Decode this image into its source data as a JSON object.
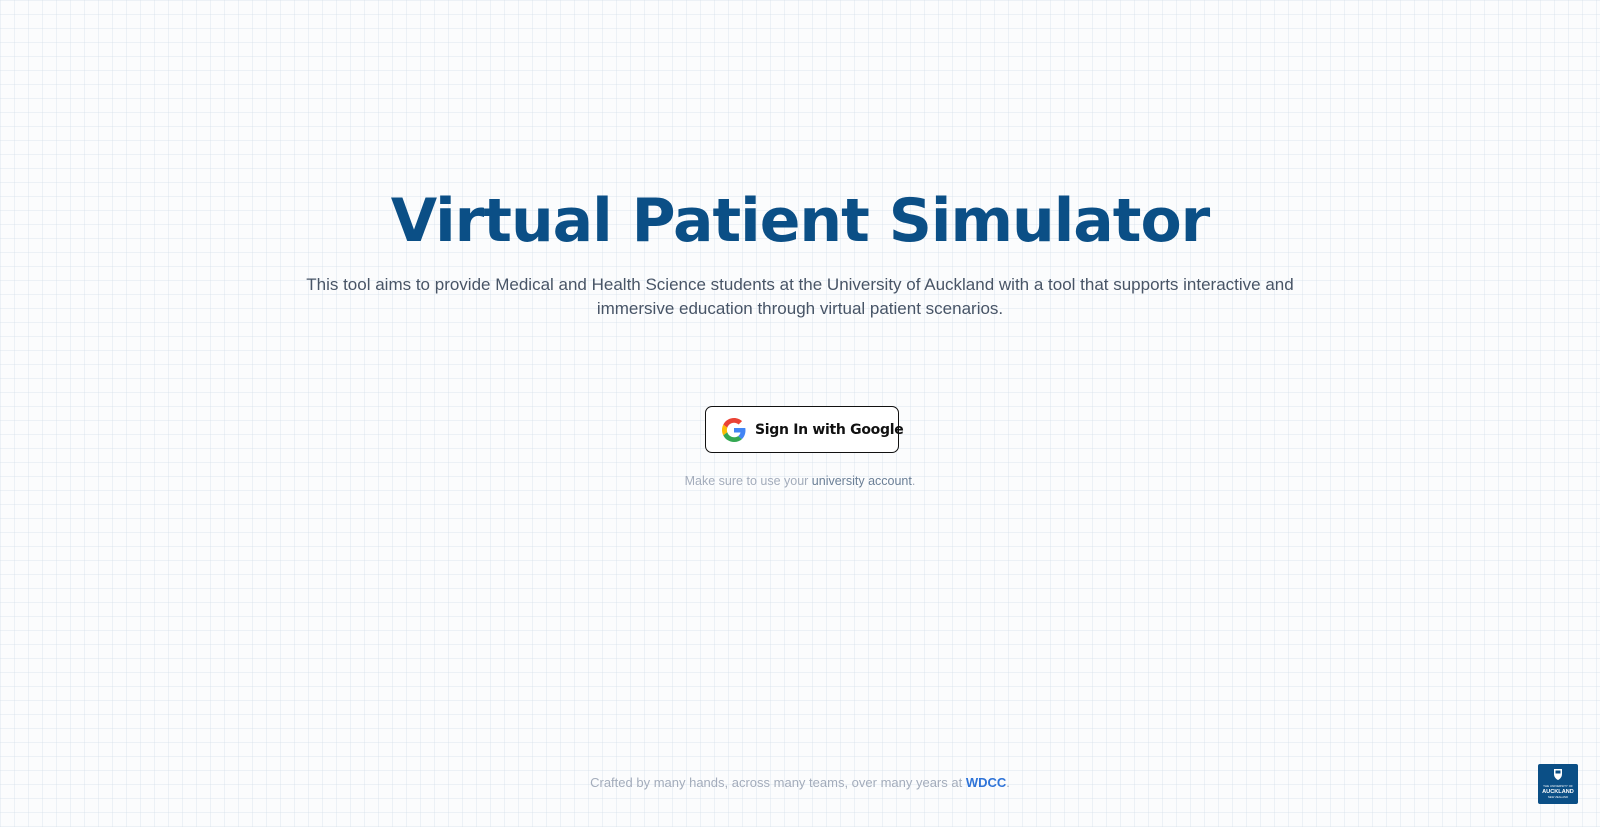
{
  "hero": {
    "title": "Virtual Patient Simulator",
    "description": "This tool aims to provide Medical and Health Science students at the University of Auckland with a tool that supports interactive and immersive education through virtual patient scenarios."
  },
  "signin": {
    "label": "Sign In with Google",
    "icon": "google-icon"
  },
  "note": {
    "prefix": "Make sure to use your ",
    "link": "university account",
    "suffix": "."
  },
  "footer": {
    "prefix": "Crafted by many hands, across many teams, over many years at ",
    "brand": "WDCC",
    "suffix": "."
  },
  "logo": {
    "icon": "university-of-auckland-logo",
    "lines": [
      "THE UNIVERSITY OF",
      "AUCKLAND",
      "NEW ZEALAND"
    ]
  },
  "colors": {
    "title": "#0b4f86",
    "brand": "#2f74d8",
    "logo_bg": "#0b4f86"
  }
}
